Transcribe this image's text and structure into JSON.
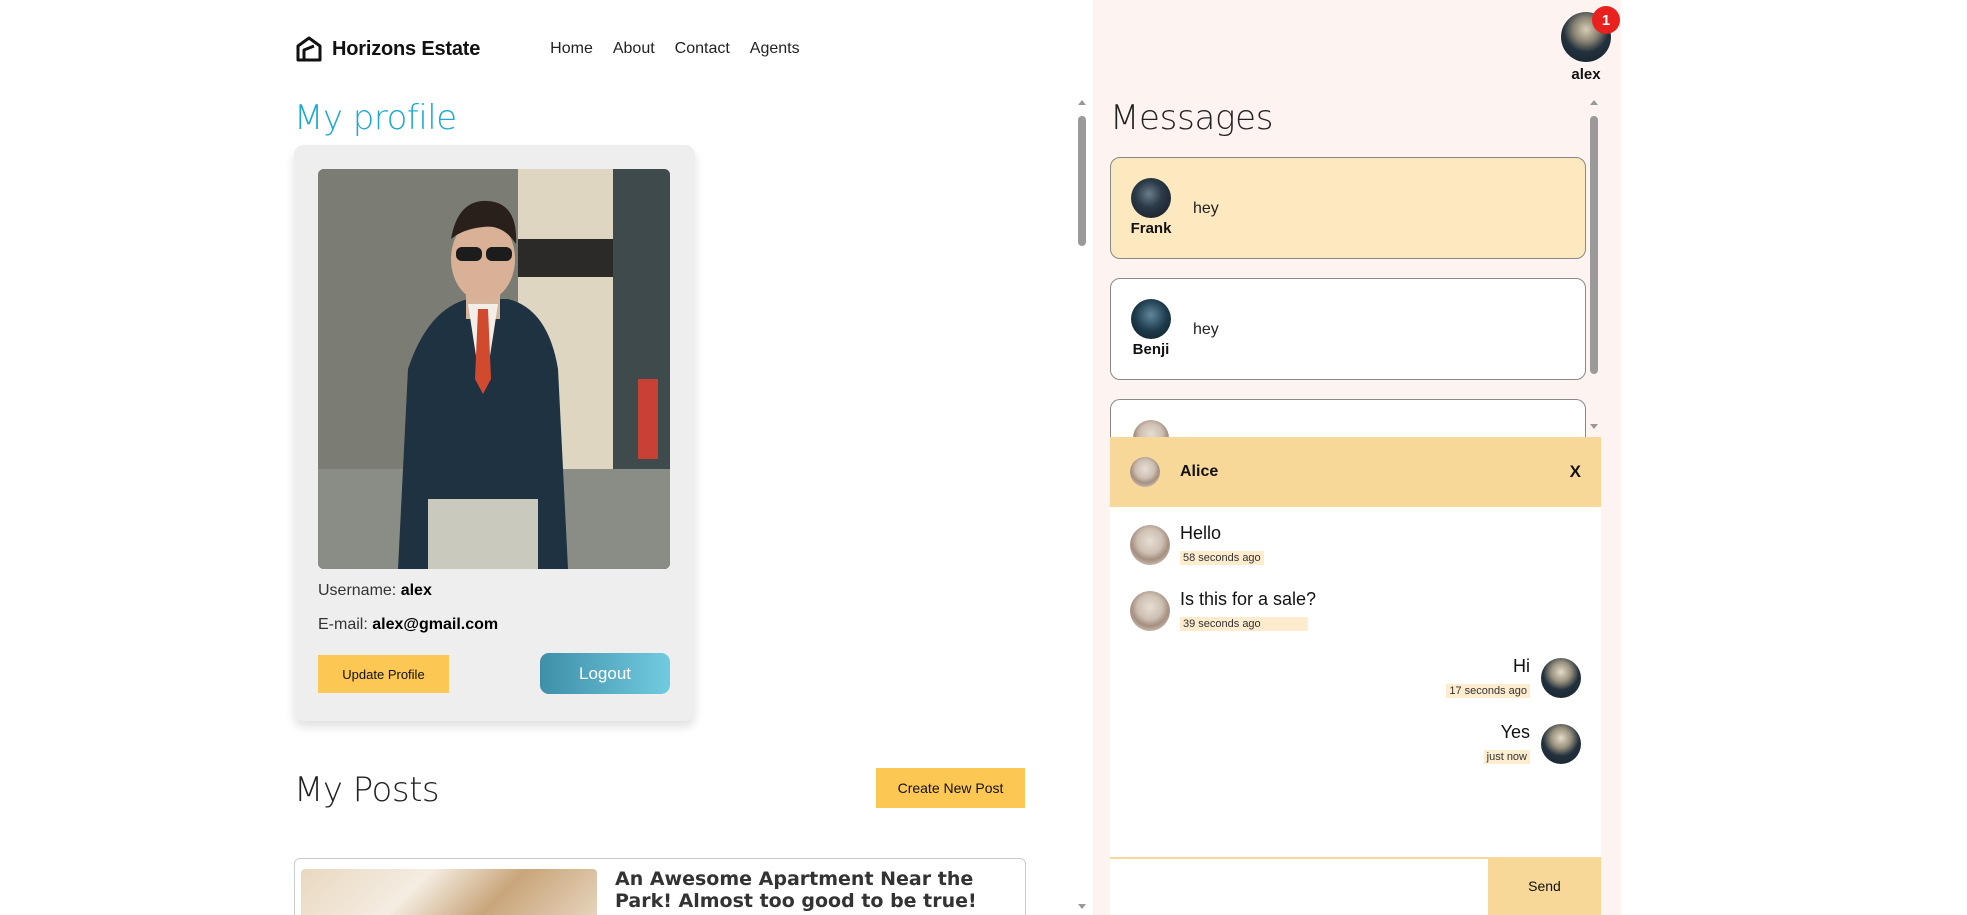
{
  "brand": {
    "name": "Horizons Estate"
  },
  "nav": {
    "items": [
      "Home",
      "About",
      "Contact",
      "Agents"
    ]
  },
  "profile": {
    "title": "My profile",
    "username_label": "Username:",
    "username": "alex",
    "email_label": "E-mail:",
    "email": "alex@gmail.com",
    "update_button": "Update Profile",
    "logout_button": "Logout"
  },
  "posts": {
    "title": "My Posts",
    "create_button": "Create New Post",
    "items": [
      {
        "title": "An Awesome Apartment Near the Park! Almost too good to be true!"
      }
    ]
  },
  "user": {
    "name": "alex",
    "notification_count": "1"
  },
  "messages": {
    "title": "Messages",
    "conversations": [
      {
        "name": "Frank",
        "last_message": "hey",
        "active": true
      },
      {
        "name": "Benji",
        "last_message": "hey",
        "active": false
      },
      {
        "name": "Alice",
        "last_message": "",
        "active": false
      }
    ]
  },
  "chat": {
    "with": "Alice",
    "close_label": "X",
    "send_label": "Send",
    "input_value": "",
    "messages": [
      {
        "from": "Alice",
        "text": "Hello",
        "time": "58 seconds ago",
        "own": false
      },
      {
        "from": "Alice",
        "text": "Is this for a sale?",
        "time": "39 seconds ago",
        "own": false
      },
      {
        "from": "alex",
        "text": "Hi",
        "time": "17 seconds ago",
        "own": true
      },
      {
        "from": "alex",
        "text": "Yes",
        "time": "just now",
        "own": true
      }
    ]
  },
  "colors": {
    "accent_yellow": "#fcc752",
    "chat_yellow": "#f8d898",
    "title_blue": "#1aa9cf",
    "badge_red": "#e8211f",
    "panel_bg": "#fdf3f1"
  }
}
